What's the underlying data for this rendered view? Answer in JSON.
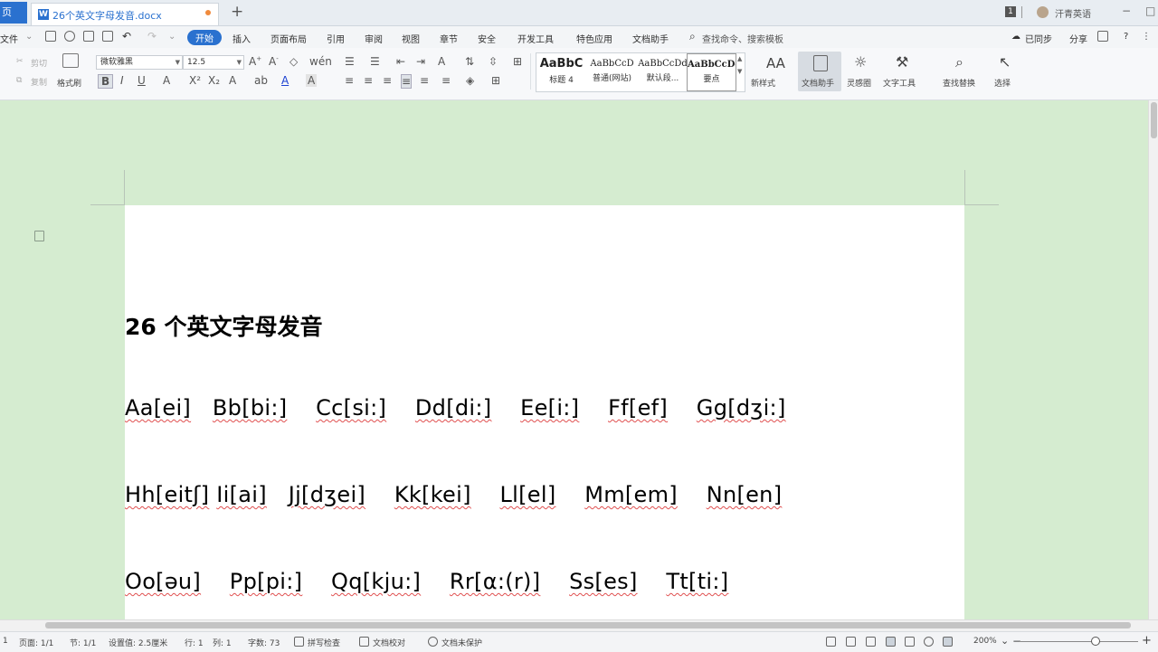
{
  "titlebar": {
    "home_tab": "页",
    "doc_tab": "26个英文字母发音.docx",
    "page_badge": "1",
    "username": "汗青英语",
    "min": "−",
    "max": "□",
    "close": "×"
  },
  "menu": {
    "file": "文件",
    "items": [
      "开始",
      "插入",
      "页面布局",
      "引用",
      "审阅",
      "视图",
      "章节",
      "安全",
      "开发工具",
      "特色应用",
      "文档助手"
    ],
    "search": "查找命令、搜索模板",
    "sync": "已同步",
    "share": "分享"
  },
  "ribbon": {
    "cut": "剪切",
    "copy": "复制",
    "format_painter": "格式刷",
    "font_name": "微软雅黑",
    "font_size": "12.5",
    "styles": [
      {
        "sample": "AaBbC",
        "name": "标题 4"
      },
      {
        "sample": "AaBbCcD",
        "name": "普通(网站)"
      },
      {
        "sample": "AaBbCcDd",
        "name": "默认段..."
      },
      {
        "sample": "AaBbCcDd",
        "name": "要点"
      }
    ],
    "new_style": "新样式",
    "doc_assistant": "文档助手",
    "inspiration": "灵感圈",
    "text_tools": "文字工具",
    "find_replace": "查找替换",
    "select": "选择"
  },
  "document": {
    "heading": "26 个英文字母发音",
    "line1": [
      "Aa[ei]",
      "Bb[bi:]",
      "Cc[si:]",
      "Dd[di:]",
      "Ee[i:]",
      "Ff[ef]",
      "Gg[dʒi:]"
    ],
    "line2": [
      "Hh[eitʃ]",
      "Ii[ai]",
      "Jj[dʒei]",
      "Kk[kei]",
      "Ll[el]",
      "Mm[em]",
      "Nn[en]"
    ],
    "line3": [
      "Oo[əu]",
      "Pp[pi:]",
      "Qq[kju:]",
      "Rr[α:(r)]",
      "Ss[es]",
      "Tt[ti:]"
    ]
  },
  "status": {
    "page_prefix": "1",
    "page": "页面: 1/1",
    "section": "节: 1/1",
    "setting": "设置值: 2.5厘米",
    "row": "行: 1",
    "col": "列: 1",
    "words": "字数: 73",
    "spell": "拼写检查",
    "proof": "文档校对",
    "protect": "文档未保护",
    "zoom": "200%"
  }
}
